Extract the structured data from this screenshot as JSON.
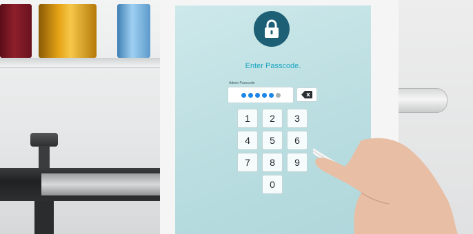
{
  "screen": {
    "title": "Enter Passcode.",
    "field_label": "Admin Passcode",
    "passcode": {
      "filled": 5,
      "total": 6
    },
    "keys": [
      "1",
      "2",
      "3",
      "4",
      "5",
      "6",
      "7",
      "8",
      "9",
      "0"
    ]
  },
  "icons": {
    "lock": "lock-icon",
    "backspace": "backspace-icon"
  },
  "colors": {
    "lock_circle": "#1d5f75",
    "title": "#1aa6c1",
    "dot_filled": "#1a86e6",
    "dot_empty": "#a7afb2"
  }
}
